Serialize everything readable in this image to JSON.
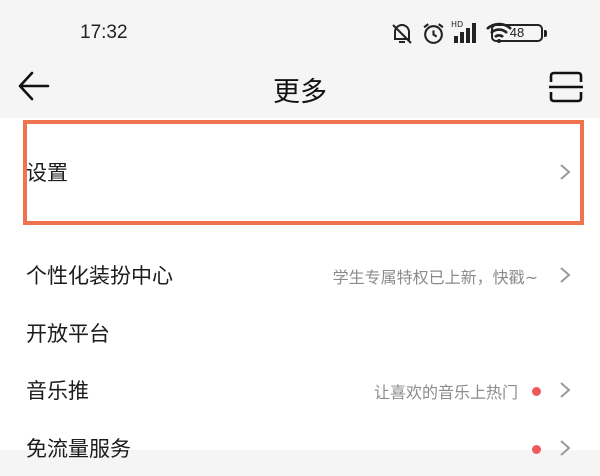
{
  "status_bar": {
    "time": "17:32",
    "battery": "48",
    "icons": [
      "mute-icon",
      "alarm-icon",
      "hd-signal-icon",
      "wifi-icon",
      "battery-icon"
    ]
  },
  "header": {
    "title": "更多",
    "back_icon": "arrow-left-icon",
    "scan_icon": "scan-icon"
  },
  "menu": [
    {
      "label": "设置",
      "hint": "",
      "dot": false,
      "chevron": true
    },
    {
      "label": "个性化装扮中心",
      "hint": "学生专属特权已上新，快戳~",
      "dot": false,
      "chevron": true
    },
    {
      "label": "开放平台",
      "hint": "",
      "dot": false,
      "chevron": false
    },
    {
      "label": "音乐推",
      "hint": "让喜欢的音乐上热门",
      "dot": true,
      "chevron": true
    },
    {
      "label": "免流量服务",
      "hint": "",
      "dot": true,
      "chevron": true
    }
  ],
  "colors": {
    "accent_highlight": "#f07350",
    "red_dot": "#ee5a5a",
    "background": "#f5f5f5",
    "panel": "#ffffff"
  }
}
